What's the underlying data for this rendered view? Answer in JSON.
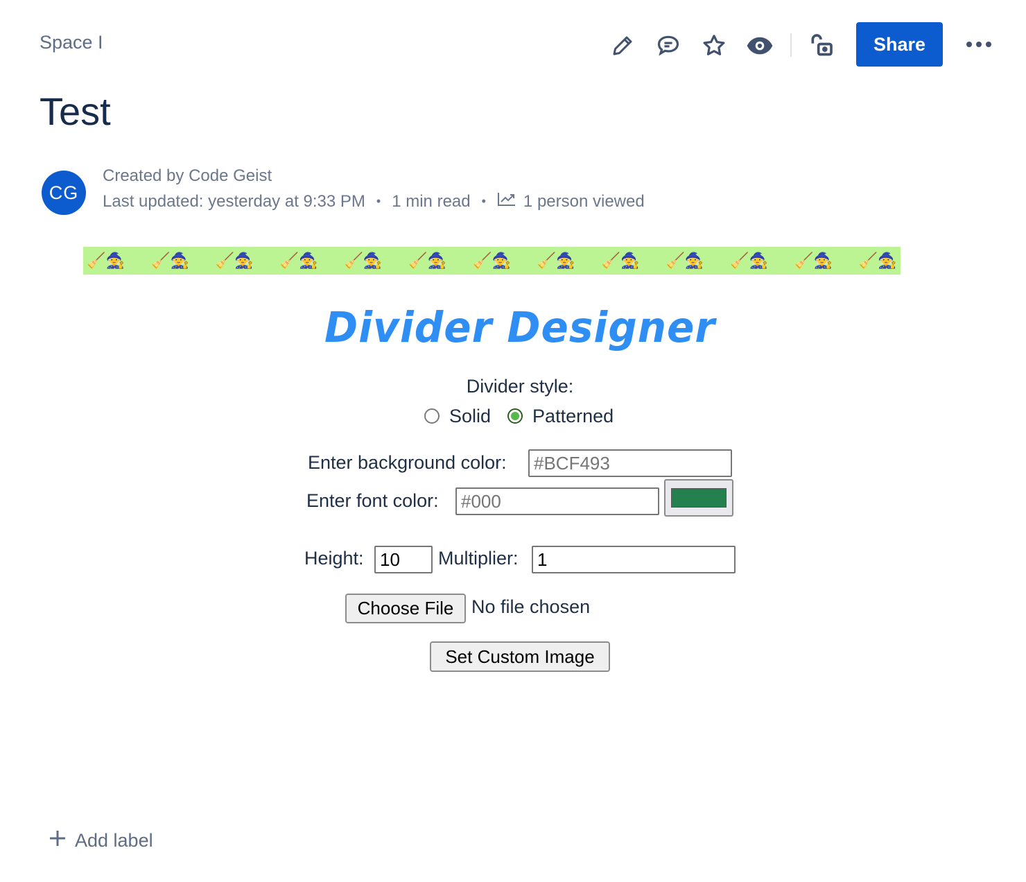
{
  "header": {
    "breadcrumb": "Space I",
    "share_label": "Share",
    "icons": [
      "edit-icon",
      "comment-icon",
      "star-icon",
      "watch-icon",
      "unlock-icon",
      "more-icon"
    ],
    "accent_color": "#0C5CD0"
  },
  "page": {
    "title": "Test"
  },
  "byline": {
    "avatar_initials": "CG",
    "created_by": "Created by Code Geist",
    "last_updated": "Last updated: yesterday at 9:33 PM",
    "read_time": "1 min read",
    "views": "1 person viewed",
    "separator": "•"
  },
  "divider": {
    "background": "#BCF493",
    "pattern_unit": "🧹🧙",
    "pattern_count": 13
  },
  "designer": {
    "title": "Divider Designer",
    "style_label": "Divider style:",
    "style_options": [
      {
        "label": "Solid",
        "checked": false
      },
      {
        "label": "Patterned",
        "checked": true
      }
    ],
    "bg_color_label": "Enter background color:",
    "bg_color_placeholder": "#BCF493",
    "font_color_label": "Enter font color:",
    "font_color_placeholder": "#000",
    "color_picker_value": "#24814F",
    "height_label": "Height:",
    "height_value": "10",
    "multiplier_label": "Multiplier:",
    "multiplier_value": "1",
    "choose_file_label": "Choose File",
    "file_status": "No file chosen",
    "set_image_label": "Set Custom Image"
  },
  "footer": {
    "add_label": "Add label"
  }
}
